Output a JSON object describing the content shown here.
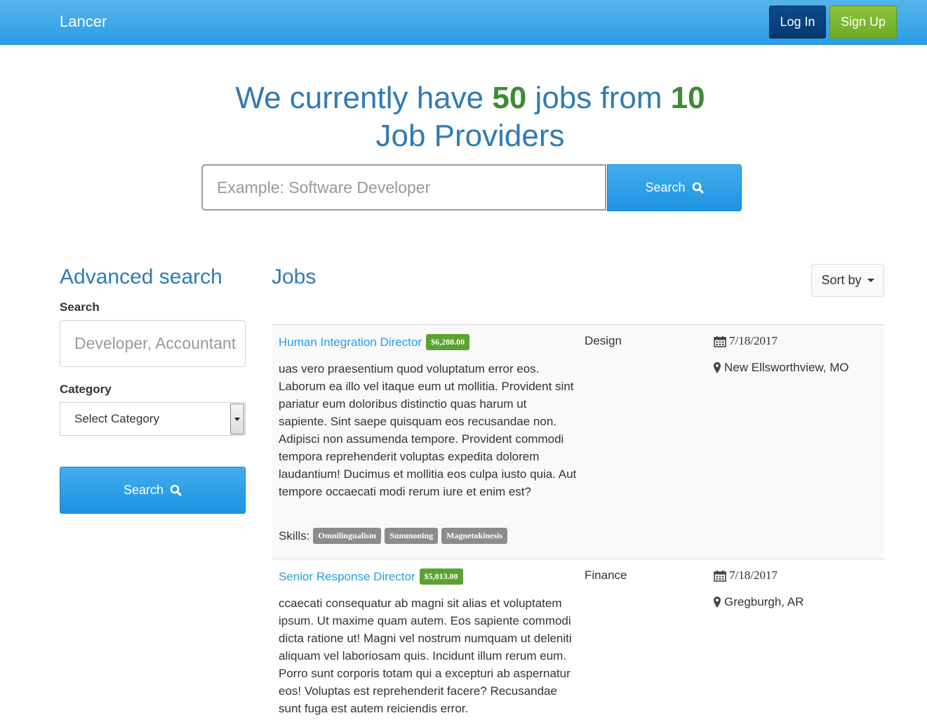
{
  "navbar": {
    "brand": "Lancer",
    "login_label": "Log In",
    "signup_label": "Sign Up"
  },
  "hero": {
    "text_1": "We currently have ",
    "jobs_count": "50",
    "text_2": " jobs from ",
    "providers_count": "10",
    "text_3": "Job Providers",
    "search_placeholder": "Example: Software Developer",
    "search_label": "Search"
  },
  "sidebar": {
    "title": "Advanced search",
    "search_label": "Search",
    "search_placeholder": "Developer, Accountant",
    "category_label": "Category",
    "category_value": "Select Category",
    "search_button": "Search"
  },
  "jobs": {
    "title": "Jobs",
    "sort_label": "Sort by",
    "skills_label": "Skills:",
    "items": [
      {
        "title": "Human Integration Director",
        "salary": "$6,288.00",
        "description": "uas vero praesentium quod voluptatum error eos. Laborum ea illo vel itaque eum ut mollitia. Provident sint pariatur eum doloribus distinctio quas harum ut sapiente. Sint saepe quisquam eos recusandae non. Adipisci non assumenda tempore. Provident commodi tempora reprehenderit voluptas expedita dolorem laudantium! Ducimus et mollitia eos culpa iusto quia. Aut tempore occaecati modi rerum iure et enim est?",
        "skills": [
          "Omnilingualism",
          "Summoning",
          "Magnetokinesis"
        ],
        "category": "Design",
        "date": "7/18/2017",
        "location": "New Ellsworthview, MO"
      },
      {
        "title": "Senior Response Director",
        "salary": "$5,813.00",
        "description": "ccaecati consequatur ab magni sit alias et voluptatem ipsum. Ut maxime quam autem. Eos sapiente commodi dicta ratione ut! Magni vel nostrum numquam ut deleniti aliquam vel laboriosam quis. Incidunt illum rerum eum. Porro sunt corporis totam qui a excepturi ab aspernatur eos! Voluptas est reprehenderit facere? Recusandae sunt fuga est autem reiciendis error.",
        "category": "Finance",
        "date": "7/18/2017",
        "location": "Gregburgh, AR"
      }
    ]
  },
  "colors": {
    "navbar": "#2a9de5",
    "heading": "#2f7bb3",
    "count": "#3f8a35",
    "login": "#073a6e",
    "signup": "#6eaa26",
    "salary": "#5aa332",
    "skill": "#8c8c8c"
  },
  "icons": {
    "search": "search-icon",
    "calendar": "calendar-icon",
    "location": "map-marker-icon",
    "caret": "caret-down-icon"
  }
}
